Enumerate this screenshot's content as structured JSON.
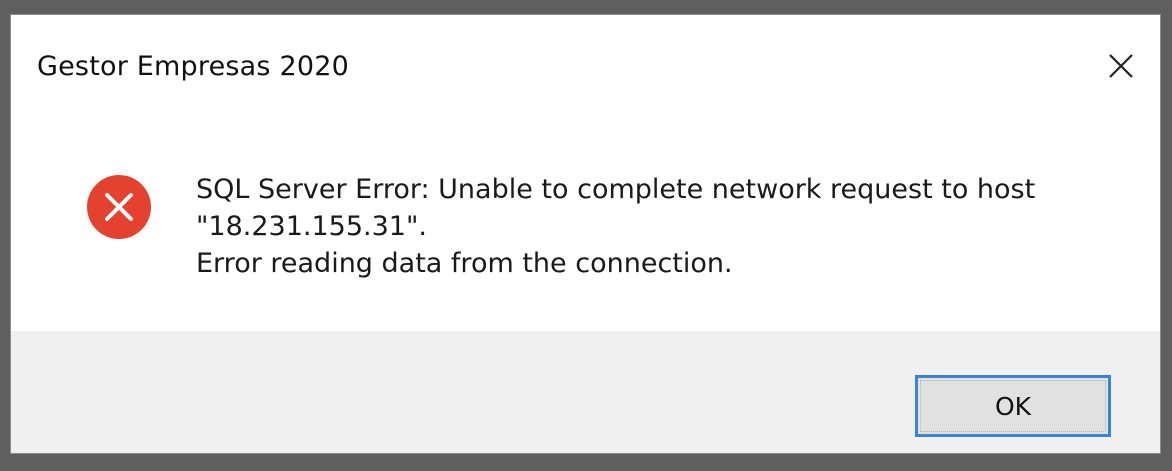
{
  "window": {
    "title": "Gestor Empresas 2020"
  },
  "icons": {
    "error": "error-icon",
    "close": "close-icon"
  },
  "message": {
    "line1": "SQL Server Error: Unable to complete network request to host",
    "line2": "\"18.231.155.31\".",
    "line3": "Error reading data from the connection."
  },
  "buttons": {
    "ok_label": "OK"
  },
  "colors": {
    "error_red": "#e5412f",
    "button_border": "#3a84d8",
    "footer_bg": "#f0f0f0"
  }
}
